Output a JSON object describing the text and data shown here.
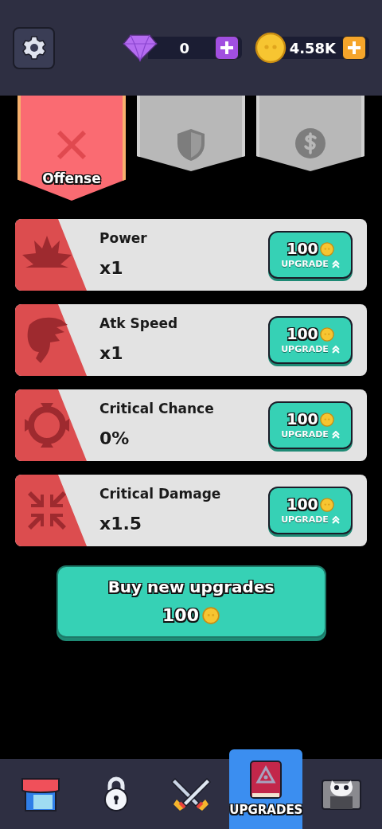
{
  "currencies": [
    {
      "kind": "gem",
      "amount": "0"
    },
    {
      "kind": "coin",
      "amount": "4.58K"
    }
  ],
  "categories": [
    {
      "kind": "swords",
      "label": "Offense",
      "selected": true
    },
    {
      "kind": "shield",
      "selected": false
    },
    {
      "kind": "dollar",
      "selected": false
    }
  ],
  "upgrades": [
    {
      "kind": "burst",
      "name": "Power",
      "value": "x1",
      "price": "100",
      "action": "UPGRADE"
    },
    {
      "kind": "fist",
      "name": "Atk Speed",
      "value": "x1",
      "price": "100",
      "action": "UPGRADE"
    },
    {
      "kind": "crosshair",
      "name": "Critical Chance",
      "value": "0%",
      "price": "100",
      "action": "UPGRADE"
    },
    {
      "kind": "arrows",
      "name": "Critical Damage",
      "value": "x1.5",
      "price": "100",
      "action": "UPGRADE"
    }
  ],
  "buy_button": {
    "label": "Buy new upgrades",
    "price": "100"
  },
  "nav": [
    {
      "kind": "shop",
      "selected": false
    },
    {
      "kind": "lock",
      "selected": false
    },
    {
      "kind": "battle",
      "selected": false
    },
    {
      "kind": "book",
      "label": "UPGRADES",
      "selected": true
    },
    {
      "kind": "skull",
      "selected": false
    }
  ]
}
